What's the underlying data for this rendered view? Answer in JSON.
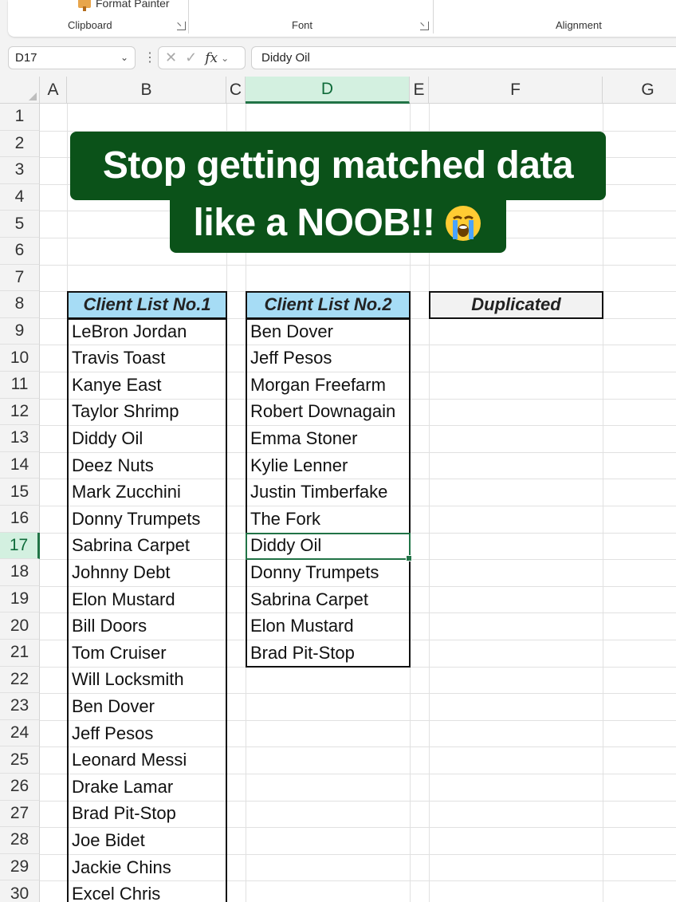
{
  "ribbon": {
    "format_painter_label": "Format Painter",
    "groups": [
      "Clipboard",
      "Font",
      "Alignment"
    ]
  },
  "formula_bar": {
    "name_box": "D17",
    "formula": "Diddy Oil",
    "fx_label": "fx"
  },
  "sheet": {
    "columns": [
      "A",
      "B",
      "C",
      "D",
      "E",
      "F",
      "G"
    ],
    "selected_column": "D",
    "rows": [
      "1",
      "2",
      "3",
      "4",
      "5",
      "6",
      "7",
      "8",
      "9",
      "10",
      "11",
      "12",
      "13",
      "14",
      "15",
      "16",
      "17",
      "18",
      "19",
      "20",
      "21",
      "22",
      "23",
      "24",
      "25",
      "26",
      "27",
      "28",
      "29",
      "30"
    ],
    "selected_row": "17",
    "active_cell": "D17"
  },
  "overlay": {
    "line1": "Stop getting matched data",
    "line2": "like a NOOB!!",
    "emoji": "loudly-crying-face-emoji",
    "bg_color": "#0b5219"
  },
  "tables": {
    "list1": {
      "header": "Client List No.1",
      "header_color": "#a6dcf5",
      "items": [
        "LeBron Jordan",
        "Travis Toast",
        "Kanye East",
        "Taylor Shrimp",
        "Diddy Oil",
        "Deez Nuts",
        "Mark Zucchini",
        "Donny Trumpets",
        "Sabrina Carpet",
        "Johnny Debt",
        "Elon Mustard",
        "Bill Doors",
        "Tom Cruiser",
        "Will Locksmith",
        "Ben Dover",
        "Jeff Pesos",
        "Leonard Messi",
        "Drake Lamar",
        "Brad Pit-Stop",
        "Joe Bidet",
        "Jackie Chins",
        "Excel Chris"
      ]
    },
    "list2": {
      "header": "Client List No.2",
      "header_color": "#a6dcf5",
      "items": [
        "Ben Dover",
        "Jeff Pesos",
        "Morgan Freefarm",
        "Robert Downagain",
        "Emma Stoner",
        "Kylie Lenner",
        "Justin Timberfake",
        "The Fork",
        "Diddy Oil",
        "Donny Trumpets",
        "Sabrina Carpet",
        "Elon Mustard",
        "Brad Pit-Stop"
      ]
    },
    "duplicated": {
      "header": "Duplicated",
      "header_color": "#f2f2f2"
    }
  }
}
